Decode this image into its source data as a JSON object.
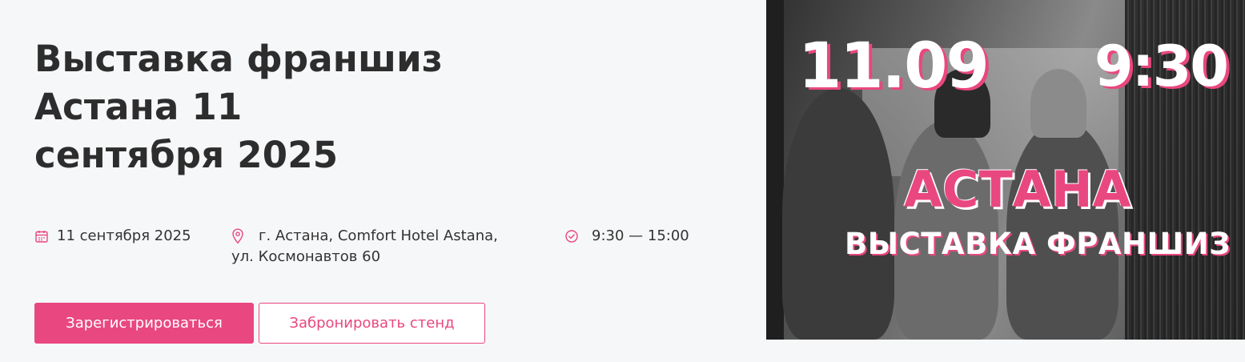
{
  "event": {
    "title_lines": [
      "Выставка франшиз",
      "Астана 11",
      "сентября 2025"
    ],
    "date": "11 сентября 2025",
    "address_line1": "г. Астана, Comfort Hotel Astana,",
    "address_line2": "ул. Космонавтов 60",
    "time": "9:30 — 15:00"
  },
  "buttons": {
    "register_label": "Зарегистрироваться",
    "book_label": "Забронировать стенд"
  },
  "banner": {
    "date": "11.09",
    "time": "9:30",
    "city": "АСТАНА",
    "subtitle": "ВЫСТАВКА ФРАНШИЗ"
  },
  "icons": {
    "date": "calendar-icon",
    "place": "location-pin-icon",
    "time": "clock-icon"
  },
  "colors": {
    "accent": "#e9477f",
    "background": "#f6f7f9",
    "text": "#2d2d2d"
  }
}
